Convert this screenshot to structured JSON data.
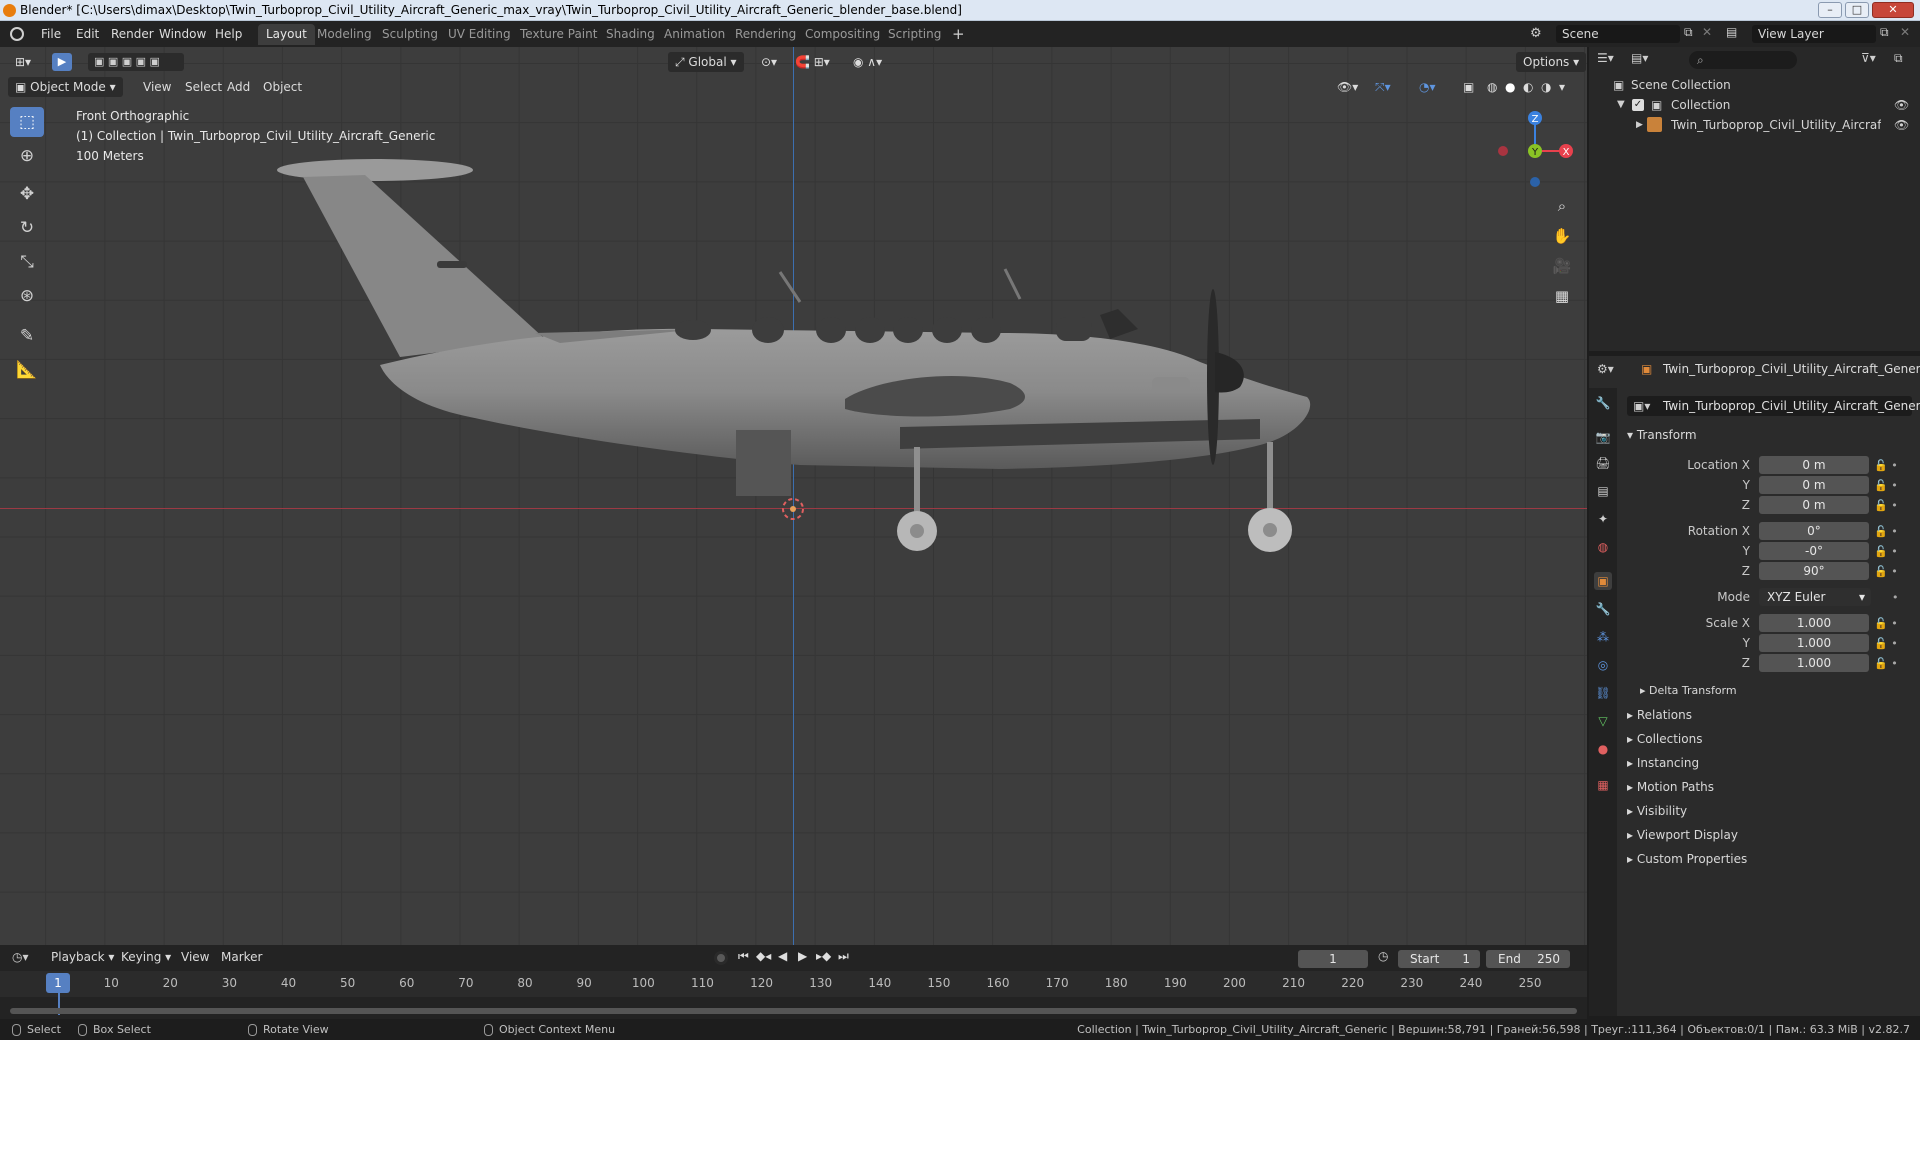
{
  "window": {
    "title": "Blender* [C:\\Users\\dimax\\Desktop\\Twin_Turboprop_Civil_Utility_Aircraft_Generic_max_vray\\Twin_Turboprop_Civil_Utility_Aircraft_Generic_blender_base.blend]"
  },
  "menu": {
    "items": [
      "File",
      "Edit",
      "Render",
      "Window",
      "Help"
    ]
  },
  "workspaces": {
    "tabs": [
      "Layout",
      "Modeling",
      "Sculpting",
      "UV Editing",
      "Texture Paint",
      "Shading",
      "Animation",
      "Rendering",
      "Compositing",
      "Scripting"
    ],
    "active": "Layout",
    "add": "+"
  },
  "scene": {
    "name": "Scene",
    "view_layer": "View Layer"
  },
  "viewport": {
    "mode": "Object Mode",
    "menus": [
      "View",
      "Select",
      "Add",
      "Object"
    ],
    "transform_orientation": "Global",
    "options": "Options",
    "view_name": "Front Orthographic",
    "collection_info": "(1) Collection | Twin_Turboprop_Civil_Utility_Aircraft_Generic",
    "scale": "100 Meters",
    "gizmo": {
      "z": "Z",
      "y": "Y",
      "x": "X"
    }
  },
  "outliner": {
    "root": "Scene Collection",
    "collection": "Collection",
    "object": "Twin_Turboprop_Civil_Utility_Aircraft_Gener"
  },
  "properties": {
    "object_name": "Twin_Turboprop_Civil_Utility_Aircraft_Generic",
    "object_field": "Twin_Turboprop_Civil_Utility_Aircraft_Generic",
    "transform": {
      "title": "Transform",
      "location_label": "Location X",
      "location": [
        "0 m",
        "0 m",
        "0 m"
      ],
      "rotation_label": "Rotation X",
      "rotation": [
        "0°",
        "-0°",
        "90°"
      ],
      "mode_label": "Mode",
      "mode": "XYZ Euler",
      "scale_label": "Scale X",
      "scale": [
        "1.000",
        "1.000",
        "1.000"
      ],
      "y": "Y",
      "z": "Z"
    },
    "delta": "Delta Transform",
    "sections": [
      "Relations",
      "Collections",
      "Instancing",
      "Motion Paths",
      "Visibility",
      "Viewport Display",
      "Custom Properties"
    ]
  },
  "timeline": {
    "menus": [
      "Playback",
      "Keying",
      "View",
      "Marker"
    ],
    "current_frame": "1",
    "start_label": "Start",
    "start": "1",
    "end_label": "End",
    "end": "250",
    "ticks": [
      "1",
      "10",
      "20",
      "30",
      "40",
      "50",
      "60",
      "70",
      "80",
      "90",
      "100",
      "110",
      "120",
      "130",
      "140",
      "150",
      "160",
      "170",
      "180",
      "190",
      "200",
      "210",
      "220",
      "230",
      "240",
      "250"
    ]
  },
  "statusbar": {
    "select": "Select",
    "box_select": "Box Select",
    "rotate_view": "Rotate View",
    "context_menu": "Object Context Menu",
    "stats": "Collection | Twin_Turboprop_Civil_Utility_Aircraft_Generic | Вершин:58,791 | Граней:56,598 | Треуг.:111,364 | Объектов:0/1 | Пам.: 63.3 MiB | v2.82.7"
  },
  "colors": {
    "accent": "#5680c2",
    "x_axis": "#e8414d",
    "y_axis": "#8ac425",
    "z_axis": "#3b82e0",
    "origin": "#e8a05a"
  }
}
